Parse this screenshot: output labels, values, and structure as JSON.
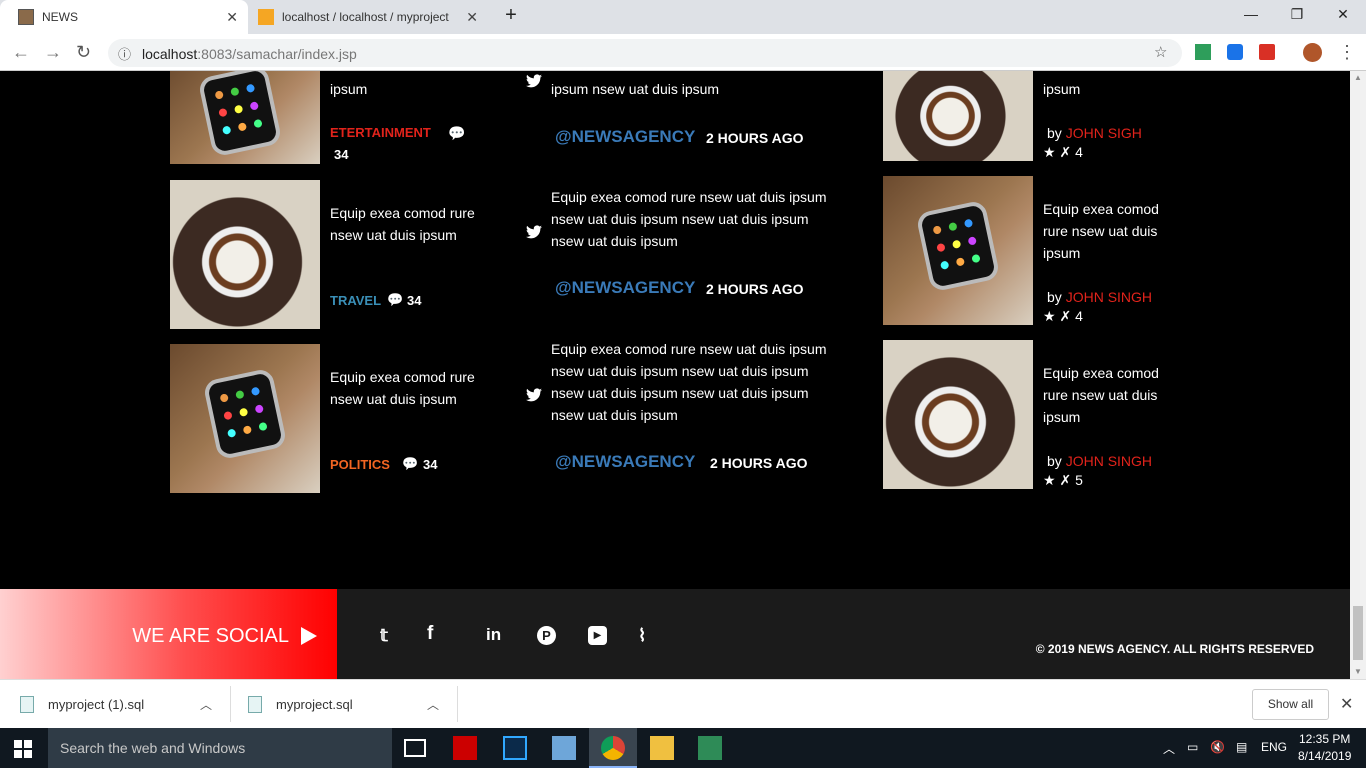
{
  "browser": {
    "tabs": [
      {
        "title": "NEWS",
        "active": true
      },
      {
        "title": "localhost / localhost / myproject",
        "active": false
      }
    ],
    "url_host": "localhost",
    "url_path": ":8083/samachar/index.jsp"
  },
  "left_column": [
    {
      "text_tail": "ipsum",
      "category": "ETERTAINMENT",
      "category_color": "#e1231b",
      "comments": "34",
      "image": "watch"
    },
    {
      "text": " Equip exea comod rure  nsew uat duis ipsum",
      "category": "TRAVEL",
      "category_color": "#3a8fb7",
      "comments": "34",
      "image": "coffee"
    },
    {
      "text": " Equip exea comod rure  nsew uat duis ipsum",
      "category": "POLITICS",
      "category_color": "#f26522",
      "comments": "34",
      "image": "watch"
    }
  ],
  "tweets": [
    {
      "text": "ipsum nsew uat duis ipsum",
      "handle": "@NEWSAGENCY",
      "time": "2 HOURS AGO"
    },
    {
      "text": " Equip exea comod rure  nsew uat duis ipsum nsew uat duis ipsum nsew uat duis ipsum nsew uat duis ipsum",
      "handle": "@NEWSAGENCY",
      "time": "2 HOURS AGO"
    },
    {
      "text": "Equip exea comod rure nsew uat duis ipsum nsew uat duis ipsum nsew uat duis ipsum nsew uat duis ipsum nsew uat duis ipsum nsew uat duis ipsum",
      "handle": "@NEWSAGENCY",
      "time": "2 HOURS AGO"
    }
  ],
  "right_column": [
    {
      "text_tail": "ipsum",
      "by": "by",
      "author": "JOHN SIGH",
      "rating": "4",
      "image": "coffee"
    },
    {
      "text": " Equip exea comod rure  nsew uat duis ipsum",
      "by": "by",
      "author": "JOHN SINGH",
      "rating": "4",
      "image": "watch"
    },
    {
      "text": " Equip exea comod rure  nsew uat duis ipsum",
      "by": "by",
      "author": "JOHN SINGH",
      "rating": "5",
      "image": "coffee"
    }
  ],
  "footer": {
    "social_label": "WE ARE SOCIAL",
    "social_icons": [
      "twitter-icon",
      "facebook-icon",
      "linkedin-icon",
      "pinterest-icon",
      "youtube-icon",
      "rss-icon"
    ],
    "copyright": "© 2019  NEWS AGENCY.  ALL RIGHTS RESERVED"
  },
  "downloads": {
    "items": [
      "myproject (1).sql",
      "myproject.sql"
    ],
    "show_all": "Show all"
  },
  "taskbar": {
    "search_placeholder": "Search the web and Windows",
    "language": "ENG",
    "time": "12:35 PM",
    "date": "8/14/2019"
  },
  "colors": {
    "accent_red": "#e1231b",
    "handle_blue": "#3a7ab8"
  }
}
